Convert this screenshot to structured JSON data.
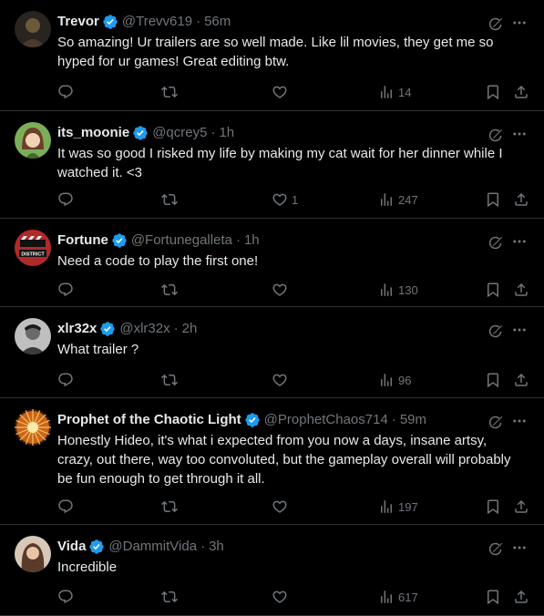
{
  "tweets": [
    {
      "name": "Trevor",
      "handle": "@Trevv619",
      "time": "56m",
      "text": "So amazing! Ur trailers are so well made. Like lil movies, they get me so hyped for ur games! Great editing btw.",
      "reply_count": "",
      "retweet_count": "",
      "like_count": "",
      "views": "14",
      "avatar_color": "#6b5a3a"
    },
    {
      "name": "its_moonie",
      "handle": "@qcrey5",
      "time": "1h",
      "text": "It was so good I risked my life by making my cat wait for her dinner while I watched it.  <3",
      "reply_count": "",
      "retweet_count": "",
      "like_count": "1",
      "views": "247",
      "avatar_color": "#7cae5a"
    },
    {
      "name": "Fortune",
      "handle": "@Fortunegalleta",
      "time": "1h",
      "text": "Need a code to play the first one!",
      "reply_count": "",
      "retweet_count": "",
      "like_count": "",
      "views": "130",
      "avatar_color": "#b02a2a",
      "avatar_logo_text": "DISTRICT"
    },
    {
      "name": "xlr32x",
      "handle": "@xlr32x",
      "time": "2h",
      "text": "What trailer ?",
      "reply_count": "",
      "retweet_count": "",
      "like_count": "",
      "views": "96",
      "avatar_color": "#3a3a3a"
    },
    {
      "name": "Prophet of the Chaotic Light",
      "handle": "@ProphetChaos714",
      "time": "59m",
      "text": "Honestly Hideo, it's what i expected from you now a days, insane artsy, crazy, out there, way too convoluted, but the gameplay overall will probably be fun enough to get through it all.",
      "reply_count": "",
      "retweet_count": "",
      "like_count": "",
      "views": "197",
      "avatar_color": "#c9641c"
    },
    {
      "name": "Vida",
      "handle": "@DammitVida",
      "time": "3h",
      "text": "Incredible",
      "reply_count": "",
      "retweet_count": "",
      "like_count": "",
      "views": "617",
      "avatar_color": "#5a3a2a"
    }
  ],
  "colors": {
    "background": "#000000",
    "text": "#e7e9ea",
    "muted": "#71767b",
    "verified": "#1d9bf0",
    "divider": "#2f3336"
  },
  "icons": {
    "reply": "reply-icon",
    "retweet": "retweet-icon",
    "like": "heart-icon",
    "views": "views-icon",
    "bookmark": "bookmark-icon",
    "share": "share-icon",
    "grok": "grok-icon",
    "more": "more-icon",
    "verified": "verified-badge-icon"
  }
}
